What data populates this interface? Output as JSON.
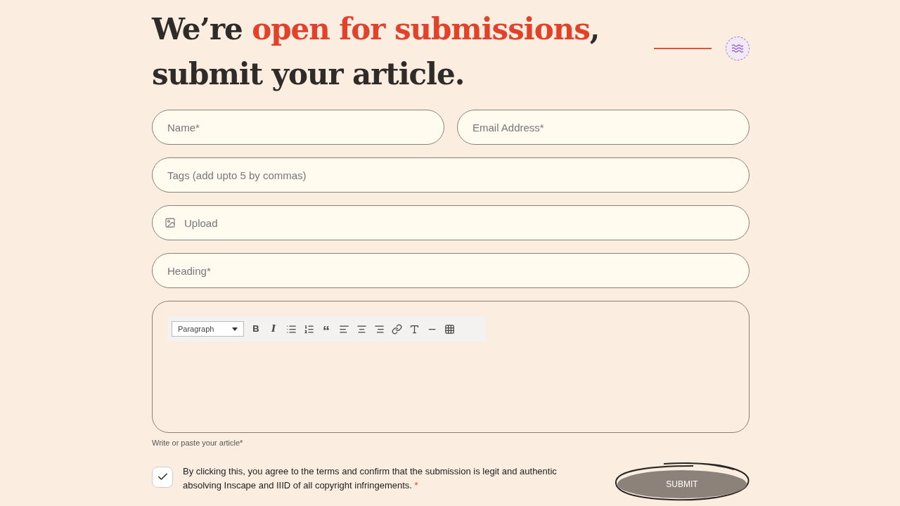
{
  "heading": {
    "lines": [
      [
        {
          "text": "We’re ",
          "highlight": false
        },
        {
          "text": "open for submissions",
          "highlight": true
        },
        {
          "text": ",",
          "highlight": false
        }
      ],
      [
        {
          "text": "submit your article.",
          "highlight": false
        }
      ]
    ]
  },
  "fields": [
    {
      "kind": "pair",
      "items": [
        {
          "placeholder": "Name*"
        },
        {
          "placeholder": "Email Address*"
        }
      ]
    },
    {
      "kind": "text",
      "items": [
        {
          "placeholder": "Tags (add upto 5 by commas)"
        }
      ]
    },
    {
      "kind": "upload",
      "items": [
        {
          "placeholder": "Upload"
        }
      ]
    },
    {
      "kind": "text",
      "items": [
        {
          "placeholder": "Heading*"
        }
      ]
    }
  ],
  "editor": {
    "format": "Paragraph",
    "tools": [
      {
        "kind": "bold",
        "label": "B"
      },
      {
        "kind": "italic",
        "label": "I"
      },
      {
        "kind": "bullets"
      },
      {
        "kind": "numbers"
      },
      {
        "kind": "quote",
        "label": "“"
      },
      {
        "kind": "align-left"
      },
      {
        "kind": "align-center"
      },
      {
        "kind": "align-right"
      },
      {
        "kind": "link"
      },
      {
        "kind": "special"
      },
      {
        "kind": "hr"
      },
      {
        "kind": "table"
      }
    ],
    "caption": "Write or paste your article*"
  },
  "consent": {
    "checked": true,
    "text": "By clicking this, you agree to the terms and confirm that the submission is legit and authentic absolving Inscape and IIID of all copyright infringements.",
    "required": "*"
  },
  "submit": "SUBMIT"
}
